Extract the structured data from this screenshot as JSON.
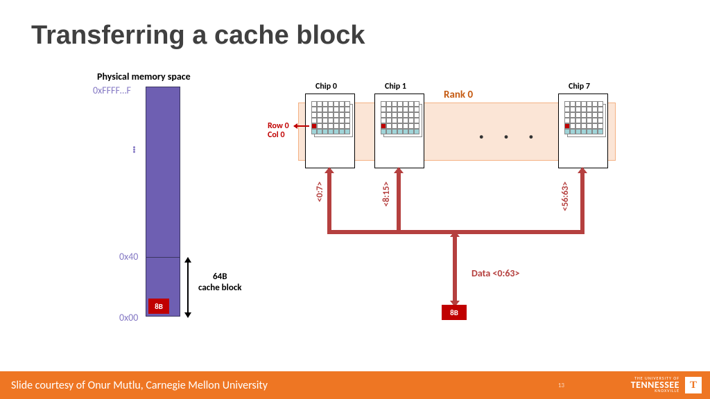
{
  "title": "Transferring a cache block",
  "physical_memory": {
    "label": "Physical memory space",
    "addr_top": "0xFFFF…F",
    "addr_mid": "0x40",
    "addr_bottom": "0x00",
    "ellipsis": "...",
    "block_label": "8B",
    "cache_block_label_line1": "64B",
    "cache_block_label_line2": "cache block"
  },
  "rank": {
    "label": "Rank 0",
    "chips": [
      {
        "label": "Chip 0",
        "bus_range": "<0:7>"
      },
      {
        "label": "Chip 1",
        "bus_range": "<8:15>"
      },
      {
        "label": "Chip 7",
        "bus_range": "<56:63>"
      }
    ],
    "ellipsis": ". . .",
    "row_col_label_line1": "Row 0",
    "row_col_label_line2": "Col 0"
  },
  "data_bus": {
    "label": "Data <0:63>",
    "box_label": "8B"
  },
  "footer": {
    "text": "Slide courtesy of Onur Mutlu, Carnegie Mellon University",
    "slide_number": "13",
    "university_top": "THE UNIVERSITY OF",
    "university_name": "TENNESSEE",
    "university_city": "KNOXVILLE",
    "icon": "T"
  }
}
